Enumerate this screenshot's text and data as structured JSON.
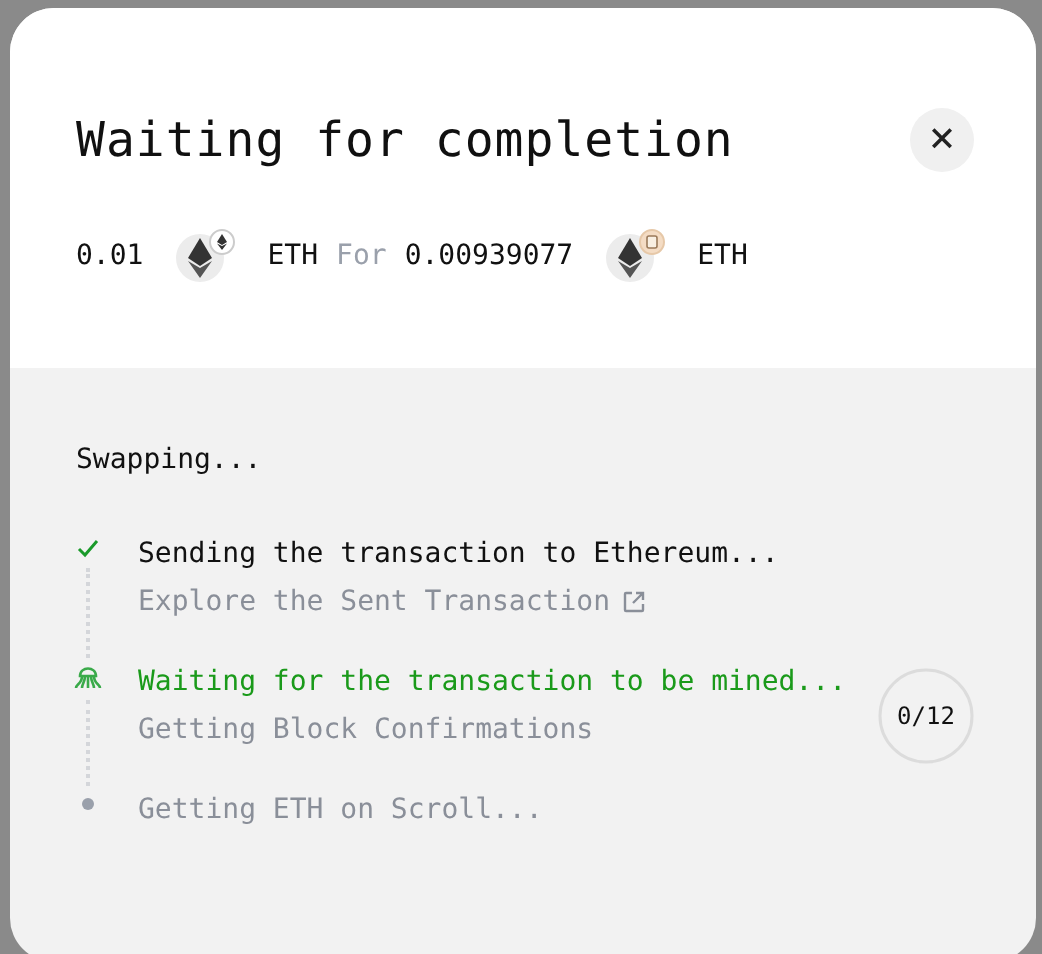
{
  "dialog": {
    "title": "Waiting for completion",
    "close": "×"
  },
  "swap": {
    "from_amount": "0.01",
    "from_token": "ETH",
    "connector": "For",
    "to_amount": "0.00939077",
    "to_token": "ETH"
  },
  "progress": {
    "heading": "Swapping...",
    "steps": [
      {
        "kind": "done",
        "title": "Sending the transaction to Ethereum...",
        "subtitle": {
          "kind": "link",
          "text": "Explore the Sent Transaction"
        }
      },
      {
        "kind": "active",
        "title": "Waiting for the transaction to be mined...",
        "subtitle": {
          "kind": "text",
          "text": "Getting Block Confirmations"
        },
        "counter": "0/12"
      },
      {
        "kind": "pending",
        "title": "Getting ETH on Scroll..."
      }
    ]
  }
}
